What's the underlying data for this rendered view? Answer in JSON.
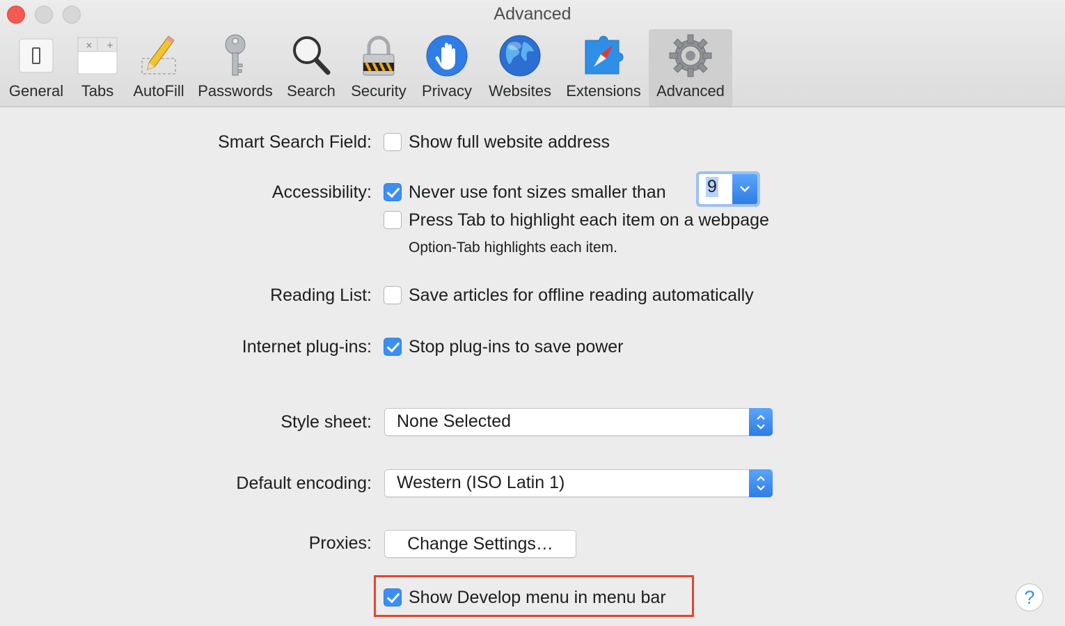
{
  "window": {
    "title": "Advanced"
  },
  "toolbar": {
    "tabs": [
      {
        "label": "General",
        "icon": "general-switch-icon"
      },
      {
        "label": "Tabs",
        "icon": "tabs-icon"
      },
      {
        "label": "AutoFill",
        "icon": "pencil-icon"
      },
      {
        "label": "Passwords",
        "icon": "key-icon"
      },
      {
        "label": "Search",
        "icon": "magnifier-icon"
      },
      {
        "label": "Security",
        "icon": "padlock-icon"
      },
      {
        "label": "Privacy",
        "icon": "hand-icon"
      },
      {
        "label": "Websites",
        "icon": "globe-icon"
      },
      {
        "label": "Extensions",
        "icon": "puzzle-compass-icon"
      },
      {
        "label": "Advanced",
        "icon": "gear-icon",
        "selected": true
      }
    ]
  },
  "settings": {
    "smart_search": {
      "label": "Smart Search Field:",
      "option": "Show full website address",
      "checked": false
    },
    "accessibility": {
      "label": "Accessibility:",
      "font_option": "Never use font sizes smaller than",
      "font_checked": true,
      "font_size_value": "9",
      "tab_option": "Press Tab to highlight each item on a webpage",
      "tab_checked": false,
      "hint": "Option-Tab highlights each item."
    },
    "reading_list": {
      "label": "Reading List:",
      "option": "Save articles for offline reading automatically",
      "checked": false
    },
    "plugins": {
      "label": "Internet plug-ins:",
      "option": "Stop plug-ins to save power",
      "checked": true
    },
    "style_sheet": {
      "label": "Style sheet:",
      "value": "None Selected"
    },
    "encoding": {
      "label": "Default encoding:",
      "value": "Western (ISO Latin 1)"
    },
    "proxies": {
      "label": "Proxies:",
      "button": "Change Settings…"
    },
    "develop": {
      "option": "Show Develop menu in menu bar",
      "checked": true
    },
    "help": "?"
  },
  "colors": {
    "accent": "#3b8ff4",
    "highlight_box": "#e8432e",
    "close_button": "#f25a52"
  }
}
